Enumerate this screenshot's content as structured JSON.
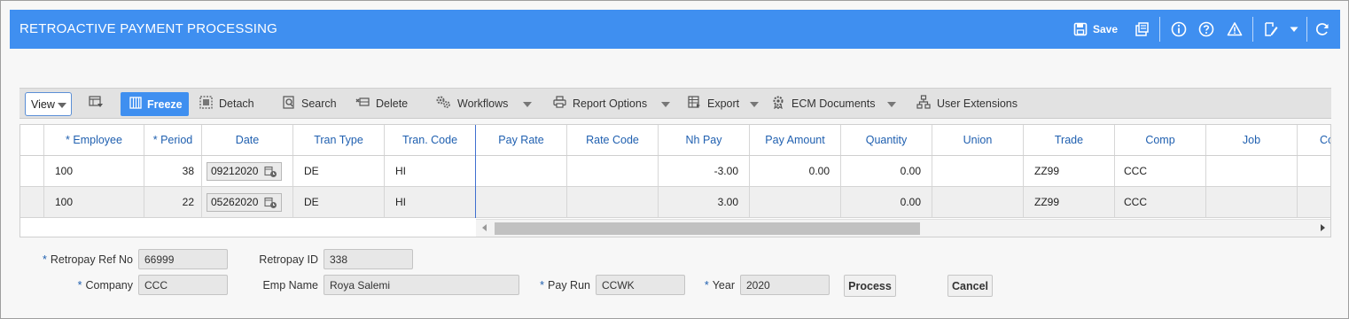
{
  "app": {
    "title": "RETROACTIVE PAYMENT PROCESSING",
    "accent": "#3f8ff0"
  },
  "header_actions": {
    "save_label": "Save",
    "icons": [
      "save-icon",
      "print-icon",
      "info-icon",
      "help-icon",
      "warning-icon",
      "edit-notes-icon",
      "chevron-down-icon",
      "refresh-icon"
    ]
  },
  "toolbar": {
    "view_label": "View",
    "freeze_label": "Freeze",
    "detach_label": "Detach",
    "search_label": "Search",
    "delete_label": "Delete",
    "workflows_label": "Workflows",
    "report_options_label": "Report Options",
    "export_label": "Export",
    "ecm_documents_label": "ECM Documents",
    "user_extensions_label": "User Extensions"
  },
  "grid": {
    "columns": [
      "* Employee",
      "* Period",
      "Date",
      "Tran Type",
      "Tran. Code",
      "Pay Rate",
      "Rate Code",
      "Nh Pay",
      "Pay Amount",
      "Quantity",
      "Union",
      "Trade",
      "Comp",
      "Job",
      "Co"
    ],
    "rows": [
      {
        "employee": "100",
        "period": "38",
        "date": "09212020",
        "tran_type": "DE",
        "tran_code": "HI",
        "pay_rate": "",
        "rate_code": "",
        "nh_pay": "-3.00",
        "pay_amount": "0.00",
        "quantity": "0.00",
        "union": "",
        "trade": "ZZ99",
        "comp": "CCC",
        "job": "",
        "co": ""
      },
      {
        "employee": "100",
        "period": "22",
        "date": "05262020",
        "tran_type": "DE",
        "tran_code": "HI",
        "pay_rate": "",
        "rate_code": "",
        "nh_pay": "3.00",
        "pay_amount": "",
        "quantity": "0.00",
        "union": "",
        "trade": "ZZ99",
        "comp": "CCC",
        "job": "",
        "co": ""
      }
    ]
  },
  "form": {
    "retropay_ref_no_label": "Retropay Ref No",
    "retropay_ref_no": "66999",
    "retropay_id_label": "Retropay ID",
    "retropay_id": "338",
    "company_label": "Company",
    "company": "CCC",
    "emp_name_label": "Emp Name",
    "emp_name": "Roya Salemi",
    "pay_run_label": "Pay Run",
    "pay_run": "CCWK",
    "year_label": "Year",
    "year": "2020",
    "required_marker": "*",
    "process_label": "Process",
    "cancel_label": "Cancel"
  }
}
